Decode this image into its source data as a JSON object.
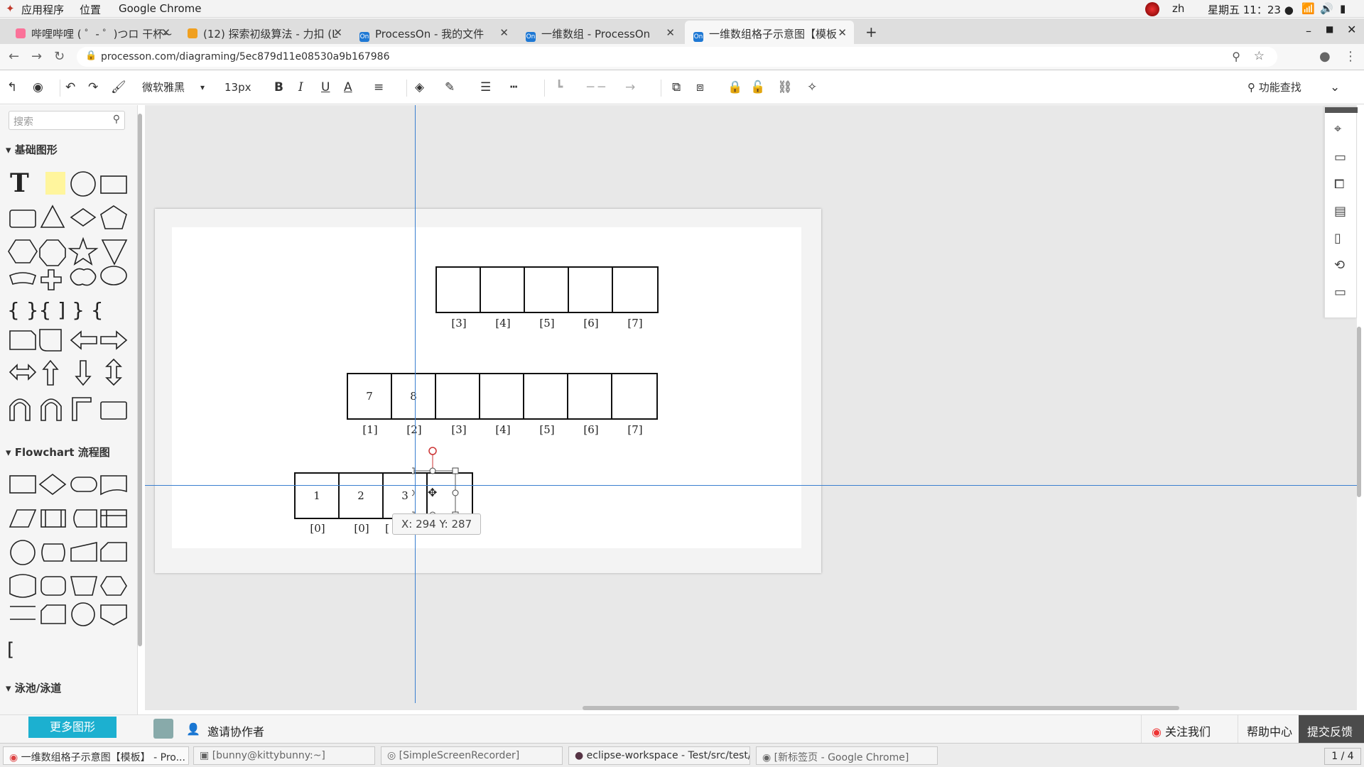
{
  "system": {
    "apps_menu": "应用程序",
    "places_menu": "位置",
    "active_app": "Google Chrome",
    "lang": "zh",
    "clock": "星期五 11：23 ●"
  },
  "tabs": [
    {
      "label": "哔哩哔哩 ( ゜- ゜)つロ 干杯~",
      "icon": "bilibili-icon"
    },
    {
      "label": "(12) 探索初级算法 - 力扣 (L",
      "icon": "leetcode-icon"
    },
    {
      "label": "ProcessOn - 我的文件",
      "icon": "processon-icon"
    },
    {
      "label": "一维数组 - ProcessOn",
      "icon": "processon-icon"
    },
    {
      "label": "一维数组格子示意图【模板",
      "icon": "processon-icon"
    }
  ],
  "favicon_text": "On",
  "address": {
    "url": "processon.com/diagraming/5ec879d11e08530a9b167986"
  },
  "toolbar": {
    "font": "微软雅黑",
    "font_size": "13px",
    "bold": "B",
    "italic": "I",
    "underline": "U",
    "font_color": "A",
    "feature_search": "功能查找"
  },
  "sidebar": {
    "search_placeholder": "搜索",
    "basic_shapes": "基础图形",
    "flowchart": "Flowchart 流程图",
    "swimlane": "泳池/泳道",
    "more_shapes": "更多图形"
  },
  "diagram": {
    "row1": {
      "cells": [
        "",
        "",
        "",
        "",
        ""
      ],
      "labels": [
        "[3]",
        "[4]",
        "[5]",
        "[6]",
        "[7]"
      ]
    },
    "row2": {
      "cells": [
        "7",
        "8",
        "",
        "",
        "",
        "",
        ""
      ],
      "labels": [
        "[1]",
        "[2]",
        "[3]",
        "[4]",
        "[5]",
        "[6]",
        "[7]"
      ]
    },
    "row3": {
      "cells": [
        "1",
        "2",
        "3",
        ""
      ],
      "labels": [
        "[0]",
        "[0]",
        "["
      ]
    }
  },
  "coords": "X: 294  Y: 287",
  "bottom": {
    "invite": "邀请协作者",
    "follow": "关注我们",
    "help": "帮助中心",
    "feedback": "提交反馈"
  },
  "taskbar": [
    {
      "label": "一维数组格子示意图【模板】 - Pro..."
    },
    {
      "label": "[bunny@kittybunny:~]"
    },
    {
      "label": "[SimpleScreenRecorder]"
    },
    {
      "label": "eclipse-workspace - Test/src/test/..."
    },
    {
      "label": "[新标签页 - Google Chrome]"
    }
  ],
  "workspace": "1 / 4"
}
